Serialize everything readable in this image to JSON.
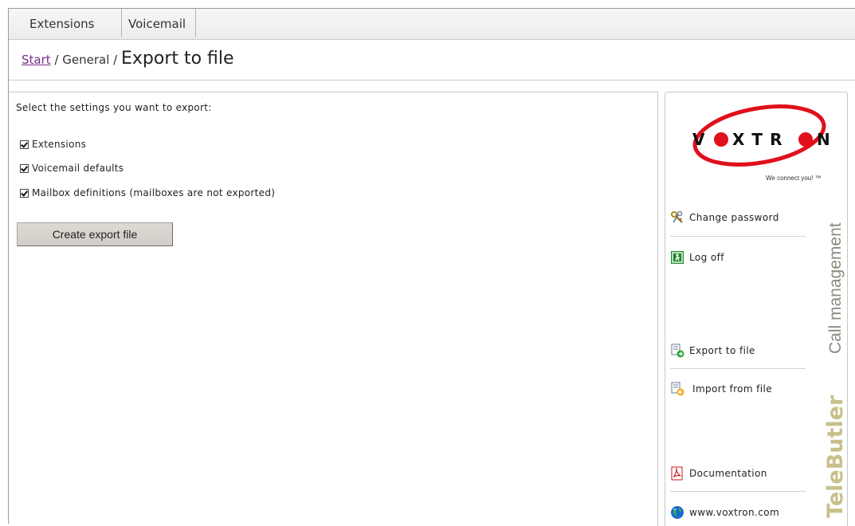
{
  "tabs": [
    {
      "label": "Extensions"
    },
    {
      "label": "Voicemail"
    }
  ],
  "breadcrumb": {
    "start": "Start",
    "separator": " / ",
    "general": "General",
    "title": "Export to file"
  },
  "main": {
    "intro": "Select the settings you want to export:",
    "options": [
      {
        "label": "Extensions",
        "checked": true
      },
      {
        "label": "Voicemail defaults",
        "checked": true
      },
      {
        "label": "Mailbox definitions (mailboxes are not exported)",
        "checked": true
      }
    ],
    "export_button": "Create export file"
  },
  "sidebar": {
    "brand": "VOXTRON",
    "tagline": "We connect you! ™",
    "items": [
      {
        "label": "Change password",
        "icon": "keys-icon"
      },
      {
        "label": "Log off",
        "icon": "exit-door-icon"
      },
      {
        "label": "Export to file",
        "icon": "export-file-icon"
      },
      {
        "label": "Import from file",
        "icon": "import-file-icon"
      },
      {
        "label": "Documentation",
        "icon": "pdf-icon"
      },
      {
        "label": "www.voxtron.com",
        "icon": "globe-icon"
      }
    ],
    "vertical_brand": "TeleButler",
    "vertical_sub": "Call management"
  },
  "colors": {
    "link": "#7b2b8c",
    "logo_ring": "#e0101c",
    "telebutler": "#c8c08a",
    "call_mgmt": "#8a8a80"
  }
}
